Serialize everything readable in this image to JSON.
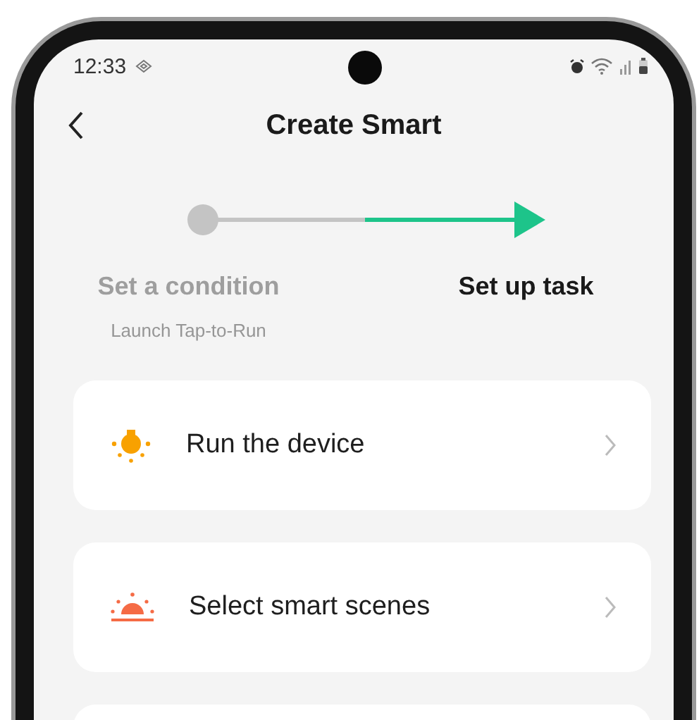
{
  "status_bar": {
    "time": "12:33"
  },
  "header": {
    "title": "Create Smart"
  },
  "steps": [
    {
      "label": "Set a condition",
      "subtitle": "Launch Tap-to-Run",
      "selected": false
    },
    {
      "label": "Set up task",
      "selected": true
    }
  ],
  "actions": [
    {
      "kind": "device",
      "label": "Run the device"
    },
    {
      "kind": "scene",
      "label": "Select smart scenes"
    }
  ]
}
